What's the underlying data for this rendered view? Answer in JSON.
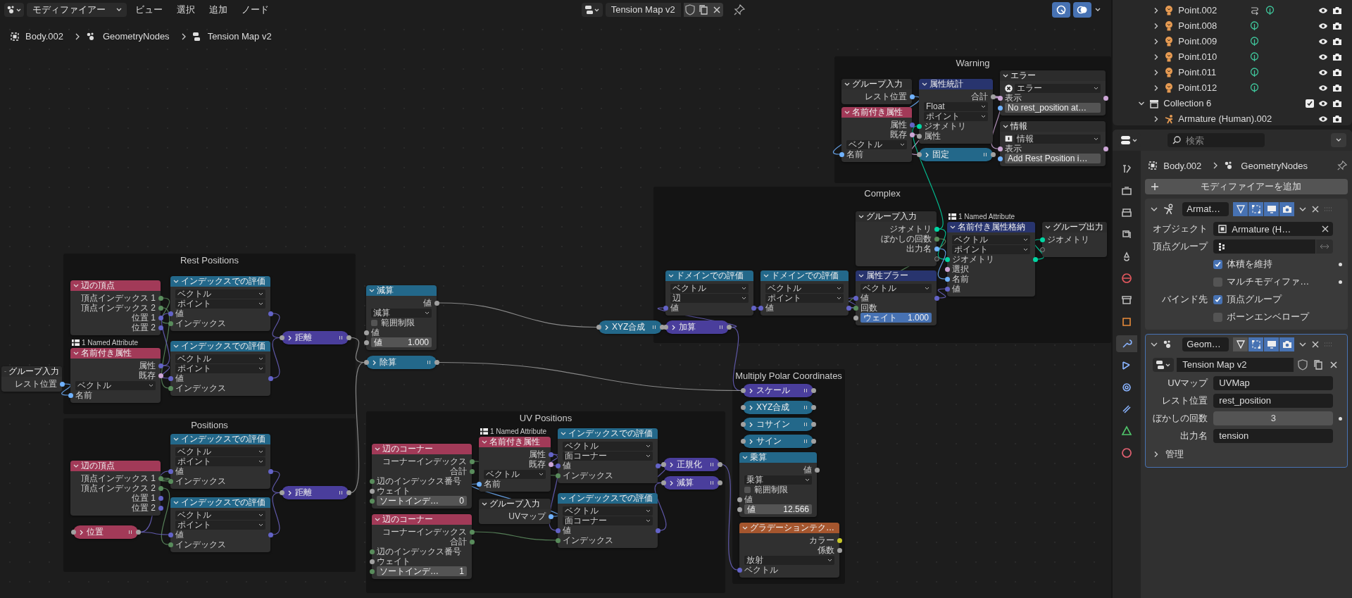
{
  "header": {
    "mode": "モディファイアー",
    "menus": [
      "ビュー",
      "選択",
      "追加",
      "ノード"
    ],
    "node_tree": "Tension Map v2"
  },
  "breadcrumb": [
    "Body.002",
    "GeometryNodes",
    "Tension Map v2"
  ],
  "frames": [
    {
      "title": "Warning",
      "nodes": [
        {
          "kind": "node",
          "header": "グループ入力",
          "color": "#2c2c2c",
          "rows": [
            {
              "kind": "out",
              "text": "レスト位置",
              "color": "#70b2ff"
            }
          ]
        },
        {
          "kind": "node",
          "header": "名前付き属性",
          "color": "#a23a58",
          "rows": [
            {
              "kind": "out",
              "text": "属性",
              "color": "#6363c7"
            },
            {
              "kind": "out",
              "text": "既存",
              "color": "#cca6d6"
            },
            {
              "kind": "select",
              "text": "ベクトル"
            },
            {
              "kind": "in",
              "text": "名前",
              "color": "#70b2ff"
            }
          ]
        },
        {
          "kind": "node",
          "header": "属性統計",
          "color": "#28346e",
          "rows": [
            {
              "kind": "out",
              "text": "合計",
              "color": "#a1a1a1"
            },
            {
              "kind": "select",
              "text": "Float"
            },
            {
              "kind": "select",
              "text": "ポイント"
            },
            {
              "kind": "in",
              "text": "ジオメトリ",
              "color": "#00d6a3"
            },
            {
              "kind": "in",
              "text": "属性",
              "color": "#a1a1a1"
            }
          ]
        },
        {
          "kind": "pill",
          "header": "固定",
          "color": "#23688a"
        },
        {
          "kind": "node",
          "header": "エラー",
          "color": "#2c2c2c",
          "rows": [
            {
              "kind": "error_select",
              "text": "エラー"
            },
            {
              "kind": "through",
              "text": "表示",
              "color": "#cca6d6"
            },
            {
              "kind": "field",
              "text": "No rest_position at…",
              "color": "#70b2ff"
            }
          ]
        },
        {
          "kind": "node",
          "header": "情報",
          "color": "#2c2c2c",
          "rows": [
            {
              "kind": "info_select",
              "text": "情報"
            },
            {
              "kind": "through",
              "text": "表示",
              "color": "#cca6d6"
            },
            {
              "kind": "field",
              "text": "Add Rest Position i…",
              "color": "#70b2ff"
            }
          ]
        }
      ]
    },
    {
      "title": "Complex",
      "nodes": [
        {
          "kind": "node",
          "header": "ドメインでの評価",
          "color": "#23688a",
          "rows": [
            {
              "kind": "select",
              "text": "ベクトル"
            },
            {
              "kind": "select",
              "text": "辺"
            },
            {
              "kind": "through",
              "text": "値",
              "color": "#6363c7"
            }
          ]
        },
        {
          "kind": "node",
          "header": "ドメインでの評価",
          "color": "#23688a",
          "rows": [
            {
              "kind": "select",
              "text": "ベクトル"
            },
            {
              "kind": "select",
              "text": "ポイント"
            },
            {
              "kind": "through",
              "text": "値",
              "color": "#6363c7"
            }
          ]
        },
        {
          "kind": "node",
          "header": "グループ入力",
          "color": "#2c2c2c",
          "rows": [
            {
              "kind": "out",
              "text": "ジオメトリ",
              "color": "#00d6a3"
            },
            {
              "kind": "out",
              "text": "ぼかしの回数",
              "color": "#598c5c"
            },
            {
              "kind": "out",
              "text": "出力名",
              "color": "#70b2ff"
            },
            {
              "kind": "spare_out"
            }
          ]
        },
        {
          "kind": "node",
          "header": "属性ブラー",
          "color": "#28346e",
          "rows": [
            {
              "kind": "select",
              "text": "ベクトル"
            },
            {
              "kind": "through",
              "text": "値",
              "color": "#6363c7"
            },
            {
              "kind": "in",
              "text": "回数",
              "color": "#598c5c"
            },
            {
              "kind": "field",
              "text": "ウェイト",
              "value": "1.000",
              "color": "#a1a1a1",
              "highlight": true
            }
          ]
        },
        {
          "kind": "node",
          "header": "名前付き属性格納",
          "color": "#28346e",
          "badge": "1 Named Attribute",
          "rows": [
            {
              "kind": "select",
              "text": "ベクトル"
            },
            {
              "kind": "select",
              "text": "ポイント"
            },
            {
              "kind": "through",
              "text": "ジオメトリ",
              "color": "#00d6a3"
            },
            {
              "kind": "in",
              "text": "選択",
              "color": "#cca6d6"
            },
            {
              "kind": "in",
              "text": "名前",
              "color": "#70b2ff"
            },
            {
              "kind": "in",
              "text": "値",
              "color": "#6363c7"
            }
          ]
        },
        {
          "kind": "node",
          "header": "グループ出力",
          "color": "#2c2c2c",
          "rows": [
            {
              "kind": "in",
              "text": "ジオメトリ",
              "color": "#00d6a3"
            },
            {
              "kind": "spare_in"
            }
          ]
        },
        {
          "kind": "pill",
          "header": "加算",
          "color": "#4a3e9c"
        }
      ]
    },
    {
      "title": "Rest Positions",
      "nodes": [
        {
          "kind": "node",
          "header": "辺の頂点",
          "color": "#a23a58",
          "rows": [
            {
              "kind": "out",
              "text": "頂点インデックス 1",
              "color": "#598c5c"
            },
            {
              "kind": "out",
              "text": "頂点インデックス 2",
              "color": "#598c5c"
            },
            {
              "kind": "out",
              "text": "位置 1",
              "color": "#6363c7"
            },
            {
              "kind": "out",
              "text": "位置 2",
              "color": "#6363c7"
            }
          ]
        },
        {
          "kind": "node",
          "header": "名前付き属性",
          "color": "#a23a58",
          "badge": "1 Named Attribute",
          "rows": [
            {
              "kind": "out",
              "text": "属性",
              "color": "#6363c7"
            },
            {
              "kind": "out",
              "text": "既存",
              "color": "#cca6d6"
            },
            {
              "kind": "select",
              "text": "ベクトル"
            },
            {
              "kind": "in",
              "text": "名前",
              "color": "#70b2ff"
            }
          ]
        },
        {
          "kind": "node",
          "header": "インデックスでの評価",
          "color": "#23688a",
          "rows": [
            {
              "kind": "select",
              "text": "ベクトル"
            },
            {
              "kind": "select",
              "text": "ポイント"
            },
            {
              "kind": "through",
              "text": "値",
              "color": "#6363c7"
            },
            {
              "kind": "in",
              "text": "インデックス",
              "color": "#598c5c"
            }
          ]
        },
        {
          "kind": "node",
          "header": "インデックスでの評価",
          "color": "#23688a",
          "rows": [
            {
              "kind": "select",
              "text": "ベクトル"
            },
            {
              "kind": "select",
              "text": "ポイント"
            },
            {
              "kind": "through",
              "text": "値",
              "color": "#6363c7"
            },
            {
              "kind": "in",
              "text": "インデックス",
              "color": "#598c5c"
            }
          ]
        },
        {
          "kind": "pill",
          "header": "距離",
          "color": "#4a3e9c"
        }
      ]
    },
    {
      "title": "Positions",
      "nodes": [
        {
          "kind": "node",
          "header": "辺の頂点",
          "color": "#a23a58",
          "rows": [
            {
              "kind": "out",
              "text": "頂点インデックス 1",
              "color": "#598c5c"
            },
            {
              "kind": "out",
              "text": "頂点インデックス 2",
              "color": "#598c5c"
            },
            {
              "kind": "out",
              "text": "位置 1",
              "color": "#6363c7"
            },
            {
              "kind": "out",
              "text": "位置 2",
              "color": "#6363c7"
            }
          ]
        },
        {
          "kind": "pill",
          "header": "位置",
          "color": "#a23a58"
        },
        {
          "kind": "node",
          "header": "インデックスでの評価",
          "color": "#23688a",
          "rows": [
            {
              "kind": "select",
              "text": "ベクトル"
            },
            {
              "kind": "select",
              "text": "ポイント"
            },
            {
              "kind": "through",
              "text": "値",
              "color": "#6363c7"
            },
            {
              "kind": "in",
              "text": "インデックス",
              "color": "#598c5c"
            }
          ]
        },
        {
          "kind": "node",
          "header": "インデックスでの評価",
          "color": "#23688a",
          "rows": [
            {
              "kind": "select",
              "text": "ベクトル"
            },
            {
              "kind": "select",
              "text": "ポイント"
            },
            {
              "kind": "through",
              "text": "値",
              "color": "#6363c7"
            },
            {
              "kind": "in",
              "text": "インデックス",
              "color": "#598c5c"
            }
          ]
        },
        {
          "kind": "pill",
          "header": "距離",
          "color": "#4a3e9c"
        }
      ]
    },
    {
      "title": "UV Positions",
      "nodes": [
        {
          "kind": "node",
          "header": "辺のコーナー",
          "color": "#a23a58",
          "rows": [
            {
              "kind": "out",
              "text": "コーナーインデックス",
              "color": "#598c5c"
            },
            {
              "kind": "out",
              "text": "合計",
              "color": "#598c5c"
            },
            {
              "kind": "in",
              "text": "辺のインデックス番号",
              "color": "#598c5c"
            },
            {
              "kind": "in",
              "text": "ウェイト",
              "color": "#a1a1a1"
            },
            {
              "kind": "field",
              "text": "ソートインデ…",
              "value": "0",
              "color": "#598c5c",
              "highlight": false
            }
          ]
        },
        {
          "kind": "node",
          "header": "辺のコーナー",
          "color": "#a23a58",
          "rows": [
            {
              "kind": "out",
              "text": "コーナーインデックス",
              "color": "#598c5c"
            },
            {
              "kind": "out",
              "text": "合計",
              "color": "#598c5c"
            },
            {
              "kind": "in",
              "text": "辺のインデックス番号",
              "color": "#598c5c"
            },
            {
              "kind": "in",
              "text": "ウェイト",
              "color": "#a1a1a1"
            },
            {
              "kind": "field",
              "text": "ソートインデ…",
              "value": "1",
              "color": "#598c5c",
              "highlight": false
            }
          ]
        },
        {
          "kind": "node",
          "header": "名前付き属性",
          "color": "#a23a58",
          "badge": "1 Named Attribute",
          "rows": [
            {
              "kind": "out",
              "text": "属性",
              "color": "#6363c7"
            },
            {
              "kind": "out",
              "text": "既存",
              "color": "#cca6d6"
            },
            {
              "kind": "select",
              "text": "ベクトル"
            },
            {
              "kind": "in",
              "text": "名前",
              "color": "#70b2ff"
            }
          ]
        },
        {
          "kind": "node",
          "header": "グループ入力",
          "color": "#2c2c2c",
          "rows": [
            {
              "kind": "out",
              "text": "UVマップ",
              "color": "#70b2ff"
            }
          ]
        },
        {
          "kind": "node",
          "header": "インデックスでの評価",
          "color": "#23688a",
          "rows": [
            {
              "kind": "select",
              "text": "ベクトル"
            },
            {
              "kind": "select",
              "text": "面コーナー"
            },
            {
              "kind": "through",
              "text": "値",
              "color": "#6363c7"
            },
            {
              "kind": "in",
              "text": "インデックス",
              "color": "#598c5c"
            }
          ]
        },
        {
          "kind": "node",
          "header": "インデックスでの評価",
          "color": "#23688a",
          "rows": [
            {
              "kind": "select",
              "text": "ベクトル"
            },
            {
              "kind": "select",
              "text": "面コーナー"
            },
            {
              "kind": "through",
              "text": "値",
              "color": "#6363c7"
            },
            {
              "kind": "in",
              "text": "インデックス",
              "color": "#598c5c"
            }
          ]
        },
        {
          "kind": "pill",
          "header": "正規化",
          "color": "#4a3e9c"
        },
        {
          "kind": "pill",
          "header": "減算",
          "color": "#4a3e9c"
        }
      ]
    },
    {
      "title": "Multiply Polar Coordinates",
      "nodes": [
        {
          "kind": "pill",
          "header": "スケール",
          "color": "#4a3e9c"
        },
        {
          "kind": "pill",
          "header": "XYZ合成",
          "color": "#23688a"
        },
        {
          "kind": "pill",
          "header": "コサイン",
          "color": "#23688a"
        },
        {
          "kind": "pill",
          "header": "サイン",
          "color": "#23688a"
        },
        {
          "kind": "node",
          "header": "乗算",
          "color": "#23688a",
          "rows": [
            {
              "kind": "out",
              "text": "値",
              "color": "#a1a1a1"
            },
            {
              "kind": "select",
              "text": "乗算"
            },
            {
              "kind": "check",
              "text": "範囲制限",
              "checked": false
            },
            {
              "kind": "in",
              "text": "値",
              "color": "#a1a1a1"
            },
            {
              "kind": "field",
              "text": "値",
              "value": "12.566",
              "color": "#a1a1a1",
              "highlight": false
            }
          ]
        },
        {
          "kind": "node",
          "header": "グラデーションテク…",
          "color": "#a5562e",
          "rows": [
            {
              "kind": "out",
              "text": "カラー",
              "color": "#c7c729"
            },
            {
              "kind": "out",
              "text": "係数",
              "color": "#a1a1a1"
            },
            {
              "kind": "select",
              "text": "放射"
            },
            {
              "kind": "in",
              "text": "ベクトル",
              "color": "#6363c7"
            }
          ]
        }
      ]
    }
  ],
  "nodes": [
    {
      "kind": "node",
      "header": "グループ入力",
      "color": "#2c2c2c",
      "rows": [
        {
          "kind": "out",
          "text": "レスト位置",
          "color": "#70b2ff"
        }
      ]
    },
    {
      "kind": "node",
      "header": "減算",
      "color": "#23688a",
      "rows": [
        {
          "kind": "out",
          "text": "値",
          "color": "#a1a1a1"
        },
        {
          "kind": "select",
          "text": "減算"
        },
        {
          "kind": "check",
          "text": "範囲制限",
          "checked": false
        },
        {
          "kind": "in",
          "text": "値",
          "color": "#a1a1a1"
        },
        {
          "kind": "field",
          "text": "値",
          "value": "1.000",
          "color": "#a1a1a1",
          "highlight": false
        }
      ]
    },
    {
      "kind": "pill",
      "header": "除算",
      "color": "#23688a"
    },
    {
      "kind": "pill",
      "header": "XYZ合成",
      "color": "#23688a"
    }
  ],
  "outliner": {
    "rows": [
      {
        "name": "Point.002",
        "kind": "light",
        "expanded": false,
        "constraint": true
      },
      {
        "name": "Point.008",
        "kind": "light",
        "expanded": false,
        "constraint": false
      },
      {
        "name": "Point.009",
        "kind": "light",
        "expanded": false,
        "constraint": false
      },
      {
        "name": "Point.010",
        "kind": "light",
        "expanded": false,
        "constraint": false
      },
      {
        "name": "Point.011",
        "kind": "light",
        "expanded": false,
        "constraint": false
      },
      {
        "name": "Point.012",
        "kind": "light",
        "expanded": false,
        "constraint": false
      },
      {
        "name": "Collection 6",
        "kind": "collection",
        "expanded": true,
        "checked": true
      },
      {
        "name": "Armature (Human).002",
        "kind": "armature",
        "expanded": false
      }
    ]
  },
  "properties": {
    "search_placeholder": "検索",
    "tabs": [
      {
        "kind": "tool",
        "selected": false
      },
      {
        "kind": "render",
        "selected": false
      },
      {
        "kind": "output",
        "selected": false
      },
      {
        "kind": "view",
        "selected": false
      },
      {
        "kind": "scene",
        "selected": false
      },
      {
        "kind": "world",
        "selected": false
      },
      {
        "kind": "collection",
        "selected": false
      },
      {
        "kind": "object",
        "selected": false
      },
      {
        "kind": "modifier",
        "selected": true
      },
      {
        "kind": "particles",
        "selected": false
      },
      {
        "kind": "physics",
        "selected": false
      },
      {
        "kind": "constraint",
        "selected": false
      },
      {
        "kind": "data",
        "selected": false
      },
      {
        "kind": "material",
        "selected": false
      }
    ],
    "breadcrumb": [
      "Body.002",
      "GeometryNodes"
    ],
    "add_button": "モディファイアーを追加",
    "modifiers": [
      {
        "kind": "armature",
        "name": "Armat…",
        "expanded": true,
        "active": false,
        "toggles": [
          true,
          true,
          true,
          true
        ],
        "fields": [
          {
            "kind": "object",
            "label": "オブジェクト",
            "value": "Armature (H…"
          },
          {
            "kind": "group",
            "label": "頂点グループ"
          },
          {
            "kind": "check",
            "text": "体積を維持",
            "checked": true,
            "keyframe": true
          },
          {
            "kind": "check",
            "text": "マルチモディファ…",
            "checked": false,
            "keyframe": true
          },
          {
            "kind": "check",
            "label": "バインド先",
            "text": "頂点グループ",
            "checked": true,
            "keyframe": false
          },
          {
            "kind": "check",
            "text": "ボーンエンベロープ",
            "checked": false,
            "keyframe": false
          }
        ]
      },
      {
        "kind": "nodes",
        "name": "Geom…",
        "expanded": true,
        "active": true,
        "toggles": [
          false,
          true,
          true,
          true
        ],
        "node_group": "Tension Map v2",
        "fields": [
          {
            "kind": "text",
            "label": "UVマップ",
            "value": "UVMap"
          },
          {
            "kind": "text",
            "label": "レスト位置",
            "value": "rest_position"
          },
          {
            "kind": "number",
            "label": "ぼかしの回数",
            "value": "3",
            "keyframe": true
          },
          {
            "kind": "text",
            "label": "出力名",
            "value": "tension"
          }
        ],
        "subpanels": [
          {
            "label": "管理",
            "expanded": false
          }
        ]
      }
    ]
  }
}
